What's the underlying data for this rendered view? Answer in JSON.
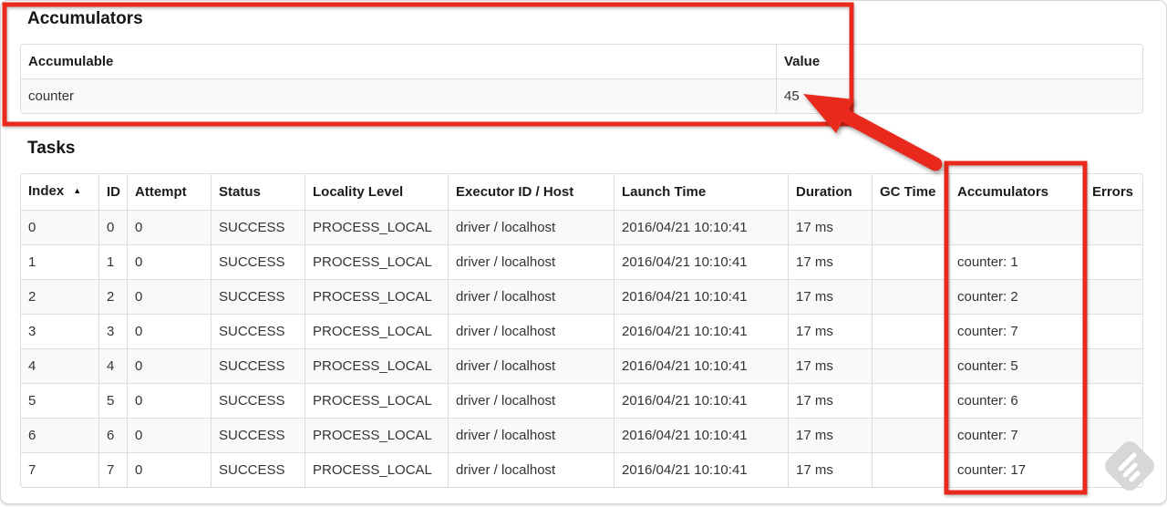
{
  "accumulators_section": {
    "title": "Accumulators",
    "table": {
      "headers": [
        "Accumulable",
        "Value"
      ],
      "rows": [
        {
          "accumulable": "counter",
          "value": "45"
        }
      ]
    }
  },
  "tasks_section": {
    "title": "Tasks",
    "table": {
      "sort_indicator": "▲",
      "headers": [
        "Index",
        "ID",
        "Attempt",
        "Status",
        "Locality Level",
        "Executor ID / Host",
        "Launch Time",
        "Duration",
        "GC Time",
        "Accumulators",
        "Errors"
      ],
      "rows": [
        {
          "index": "0",
          "id": "0",
          "attempt": "0",
          "status": "SUCCESS",
          "locality_level": "PROCESS_LOCAL",
          "executor": "driver / localhost",
          "launch_time": "2016/04/21 10:10:41",
          "duration": "17 ms",
          "gc_time": "",
          "accumulators": "",
          "errors": ""
        },
        {
          "index": "1",
          "id": "1",
          "attempt": "0",
          "status": "SUCCESS",
          "locality_level": "PROCESS_LOCAL",
          "executor": "driver / localhost",
          "launch_time": "2016/04/21 10:10:41",
          "duration": "17 ms",
          "gc_time": "",
          "accumulators": "counter: 1",
          "errors": ""
        },
        {
          "index": "2",
          "id": "2",
          "attempt": "0",
          "status": "SUCCESS",
          "locality_level": "PROCESS_LOCAL",
          "executor": "driver / localhost",
          "launch_time": "2016/04/21 10:10:41",
          "duration": "17 ms",
          "gc_time": "",
          "accumulators": "counter: 2",
          "errors": ""
        },
        {
          "index": "3",
          "id": "3",
          "attempt": "0",
          "status": "SUCCESS",
          "locality_level": "PROCESS_LOCAL",
          "executor": "driver / localhost",
          "launch_time": "2016/04/21 10:10:41",
          "duration": "17 ms",
          "gc_time": "",
          "accumulators": "counter: 7",
          "errors": ""
        },
        {
          "index": "4",
          "id": "4",
          "attempt": "0",
          "status": "SUCCESS",
          "locality_level": "PROCESS_LOCAL",
          "executor": "driver / localhost",
          "launch_time": "2016/04/21 10:10:41",
          "duration": "17 ms",
          "gc_time": "",
          "accumulators": "counter: 5",
          "errors": ""
        },
        {
          "index": "5",
          "id": "5",
          "attempt": "0",
          "status": "SUCCESS",
          "locality_level": "PROCESS_LOCAL",
          "executor": "driver / localhost",
          "launch_time": "2016/04/21 10:10:41",
          "duration": "17 ms",
          "gc_time": "",
          "accumulators": "counter: 6",
          "errors": ""
        },
        {
          "index": "6",
          "id": "6",
          "attempt": "0",
          "status": "SUCCESS",
          "locality_level": "PROCESS_LOCAL",
          "executor": "driver / localhost",
          "launch_time": "2016/04/21 10:10:41",
          "duration": "17 ms",
          "gc_time": "",
          "accumulators": "counter: 7",
          "errors": ""
        },
        {
          "index": "7",
          "id": "7",
          "attempt": "0",
          "status": "SUCCESS",
          "locality_level": "PROCESS_LOCAL",
          "executor": "driver / localhost",
          "launch_time": "2016/04/21 10:10:41",
          "duration": "17 ms",
          "gc_time": "",
          "accumulators": "counter: 17",
          "errors": ""
        }
      ]
    }
  },
  "annotations": {
    "color": "#e8291c"
  },
  "watermark": {
    "body_color": "#d7d7d7",
    "stripe_color": "#ffffff"
  }
}
